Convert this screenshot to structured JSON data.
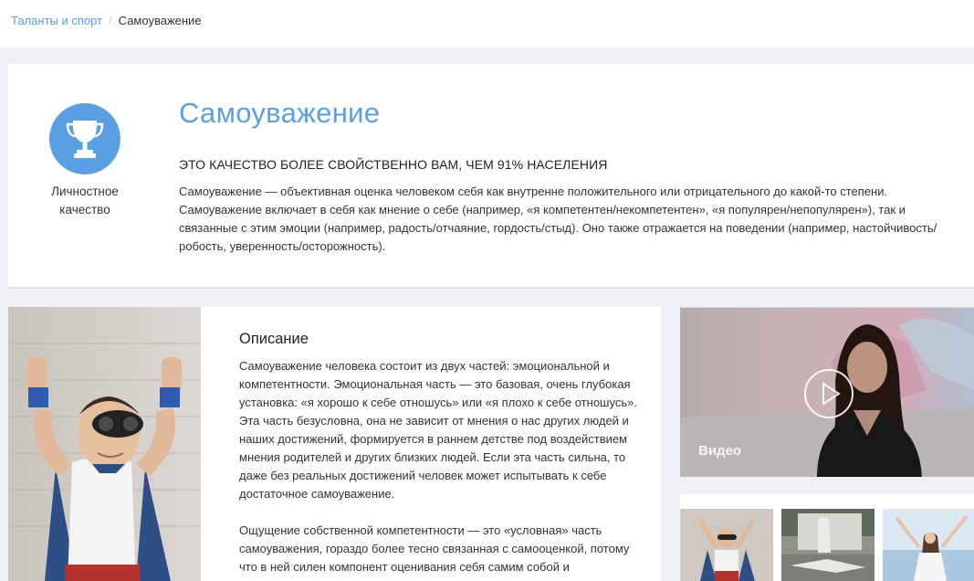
{
  "breadcrumb": {
    "parent": "Таланты и спорт",
    "separator": "/",
    "current": "Самоуважение"
  },
  "hero": {
    "icon": "trophy-icon",
    "icon_label": "Личностное качество",
    "title": "Самоуважение",
    "subtitle": "ЭТО КАЧЕСТВО БОЛЕЕ СВОЙСТВЕННО ВАМ, ЧЕМ 91% НАСЕЛЕНИЯ",
    "text": "Самоуважение — объективная оценка человеком себя как внутренне положительного или отрицательного до какой-то степени. Самоуважение включает в себя как мнение о себе (например, «я компетентен/некомпетентен», «я популярен/непопулярен»), так и связанные с этим эмоции (например, радость/отчаяние, гордость/стыд). Оно также отражается на поведении (например, настойчивость/робость, уверенность/осторожность)."
  },
  "description": {
    "title": "Описание",
    "paragraphs": [
      "Самоуважение человека состоит из двух частей: эмоциональной и компетентности. Эмоциональная часть — это базовая, очень глубокая установка: «я хорошо к себе отношусь» или «я плохо к себе отношусь». Эта часть безусловна, она не зависит от мнения о нас других людей и наших достижений, формируется в раннем детстве под воздействием мнения родителей и других близких людей. Если эта часть сильна, то даже без реальных достижений человек может испытывать к себе достаточное самоуважение.",
      "Ощущение собственной компетентности — это «условная» часть самоуважения, гораздо более тесно связанная с самооценкой, потому что в ней силен компонент оценивания себя самим собой и"
    ]
  },
  "video": {
    "label": "Видео",
    "play_icon": "play-icon"
  },
  "colors": {
    "accent": "#5b9fe3",
    "page_bg": "#eef0f5",
    "card_bg": "#ffffff"
  }
}
